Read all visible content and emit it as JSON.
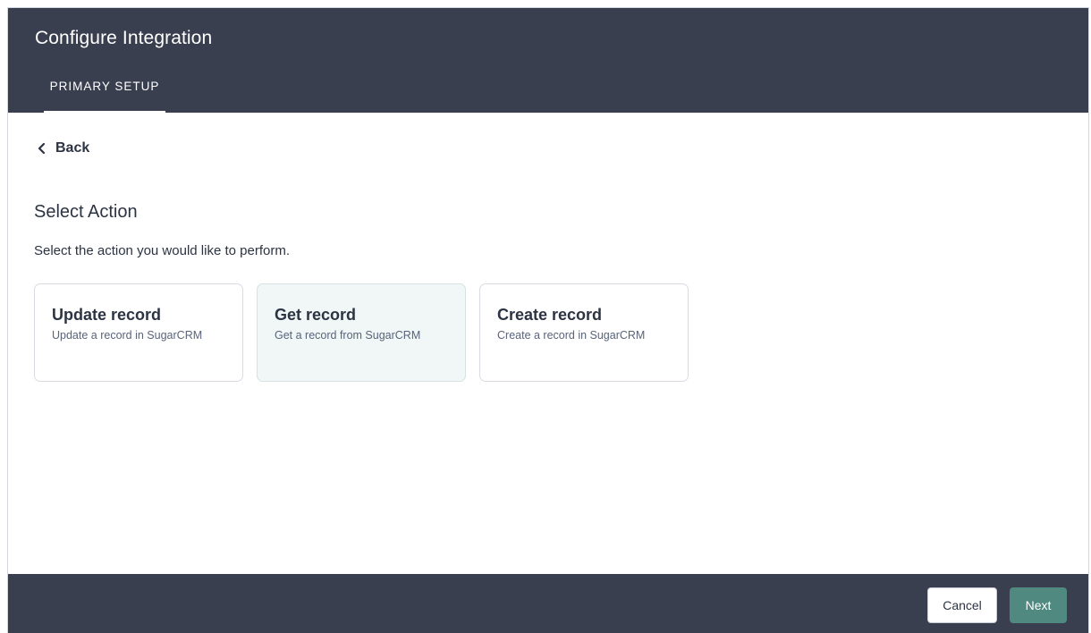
{
  "header": {
    "title": "Configure Integration",
    "tab_label": "PRIMARY SETUP"
  },
  "nav": {
    "back_label": "Back",
    "back_icon": "chevron-left-icon"
  },
  "content": {
    "title": "Select Action",
    "description": "Select the action you would like to perform.",
    "actions": [
      {
        "title": "Update record",
        "subtitle": "Update a record in SugarCRM",
        "selected": false
      },
      {
        "title": "Get record",
        "subtitle": "Get a record from SugarCRM",
        "selected": true
      },
      {
        "title": "Create record",
        "subtitle": "Create a record in SugarCRM",
        "selected": false
      }
    ]
  },
  "footer": {
    "cancel_label": "Cancel",
    "next_label": "Next"
  },
  "colors": {
    "header_bg": "#3a3f4f",
    "accent": "#4f8980",
    "selected_card_bg": "#f0f7f6"
  }
}
